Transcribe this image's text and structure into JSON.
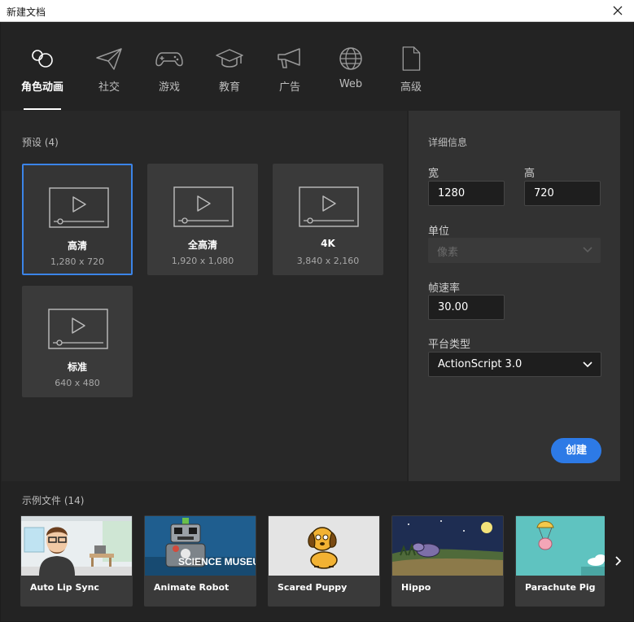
{
  "window": {
    "title": "新建文档"
  },
  "categories": [
    {
      "label": "角色动画",
      "icon": "character-animation-icon",
      "active": true
    },
    {
      "label": "社交",
      "icon": "paper-plane-icon",
      "active": false
    },
    {
      "label": "游戏",
      "icon": "gamepad-icon",
      "active": false
    },
    {
      "label": "教育",
      "icon": "graduation-cap-icon",
      "active": false
    },
    {
      "label": "广告",
      "icon": "megaphone-icon",
      "active": false
    },
    {
      "label": "Web",
      "icon": "globe-icon",
      "active": false
    },
    {
      "label": "高级",
      "icon": "document-icon",
      "active": false
    }
  ],
  "presets": {
    "title": "预设 (4)",
    "items": [
      {
        "name": "高清",
        "size": "1,280 x 720",
        "selected": true
      },
      {
        "name": "全高清",
        "size": "1,920 x 1,080",
        "selected": false
      },
      {
        "name": "4K",
        "size": "3,840 x 2,160",
        "selected": false
      },
      {
        "name": "标准",
        "size": "640 x 480",
        "selected": false
      }
    ]
  },
  "details": {
    "title": "详细信息",
    "width_label": "宽",
    "width_value": "1280",
    "height_label": "高",
    "height_value": "720",
    "units_label": "单位",
    "units_value": "像素",
    "fps_label": "帧速率",
    "fps_value": "30.00",
    "platform_label": "平台类型",
    "platform_value": "ActionScript 3.0",
    "create_label": "创建"
  },
  "samples": {
    "title": "示例文件 (14)",
    "items": [
      {
        "name": "Auto Lip Sync"
      },
      {
        "name": "Animate Robot",
        "thumb_text": "SCIENCE MUSEUM"
      },
      {
        "name": "Scared Puppy"
      },
      {
        "name": "Hippo"
      },
      {
        "name": "Parachute Pig"
      }
    ]
  },
  "colors": {
    "accent": "#2d7ae6",
    "selected_border": "#3b84e8",
    "background": "#232323",
    "panel": "#282828",
    "right_panel": "#323232"
  }
}
